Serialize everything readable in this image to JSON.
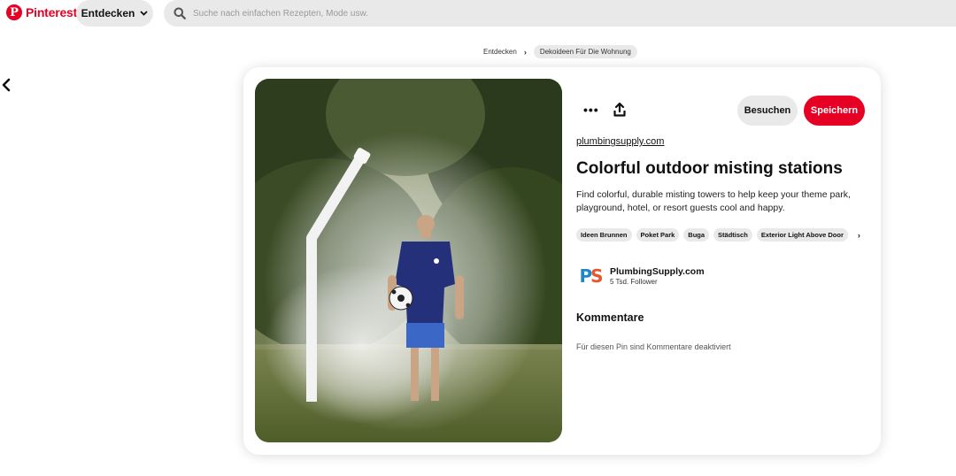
{
  "header": {
    "brand": "Pinterest",
    "explore_label": "Entdecken",
    "search_placeholder": "Suche nach einfachen Rezepten, Mode usw."
  },
  "breadcrumb": {
    "items": [
      "Entdecken",
      "Dekoideen Für Die Wohnung"
    ]
  },
  "pin": {
    "visit_label": "Besuchen",
    "save_label": "Speichern",
    "source": "plumbingsupply.com",
    "title": "Colorful outdoor misting stations",
    "description": "Find colorful, durable misting towers to help keep your theme park, playground, hotel, or resort guests cool and happy.",
    "tags": [
      "Ideen Brunnen",
      "Poket Park",
      "Buga",
      "Städtisch",
      "Exterior Light Above Door"
    ]
  },
  "creator": {
    "avatar_text": "PS",
    "name": "PlumbingSupply.com",
    "followers": "5 Tsd. Follower"
  },
  "comments": {
    "heading": "Kommentare",
    "note": "Für diesen Pin sind Kommentare deaktiviert"
  },
  "colors": {
    "brand_red": "#e60023",
    "pill_gray": "#e9e9e9"
  },
  "icons": {
    "logo": "pinterest-logo-icon",
    "search": "search-icon",
    "back": "chevron-left-icon",
    "more": "more-icon",
    "share": "share-icon",
    "tags_next": "chevron-right-icon"
  }
}
